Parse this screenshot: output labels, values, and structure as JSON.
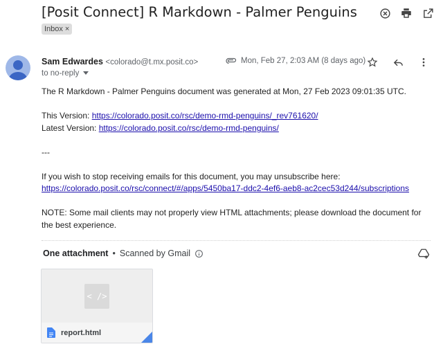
{
  "subject": "[Posit Connect] R Markdown - Palmer Penguins",
  "label_chip": {
    "text": "Inbox",
    "remove": "×"
  },
  "sender": {
    "name": "Sam Edwardes",
    "email": "<colorado@t.mx.posit.co>",
    "to": "to no-reply"
  },
  "meta": {
    "date": "Mon, Feb 27, 2:03 AM (8 days ago)"
  },
  "icons": {
    "top": [
      "close-circle-icon",
      "print-icon",
      "open-in-new-icon"
    ],
    "message": [
      "star-icon",
      "reply-icon",
      "more-vert-icon"
    ]
  },
  "body": {
    "line1": "The R Markdown - Palmer Penguins document was generated at Mon, 27 Feb 2023 09:01:35 UTC.",
    "this_version_label": "This Version: ",
    "this_version_url": "https://colorado.posit.co/rsc/demo-rmd-penguins/_rev761620/",
    "latest_version_label": "Latest Version: ",
    "latest_version_url": "https://colorado.posit.co/rsc/demo-rmd-penguins/",
    "separator": "---",
    "unsubscribe_text": "If you wish to stop receiving emails for this document, you may unsubscribe here:",
    "unsubscribe_url": "https://colorado.posit.co/rsc/connect/#/apps/5450ba17-ddc2-4ef6-aeb8-ac2cec53d244/subscriptions",
    "note": "NOTE: Some mail clients may not properly view HTML attachments; please download the document for the best experience."
  },
  "attachments": {
    "title": "One attachment",
    "dot": "•",
    "scanned": "Scanned by Gmail",
    "files": [
      {
        "name": "report.html",
        "thumb": "< />"
      }
    ]
  }
}
